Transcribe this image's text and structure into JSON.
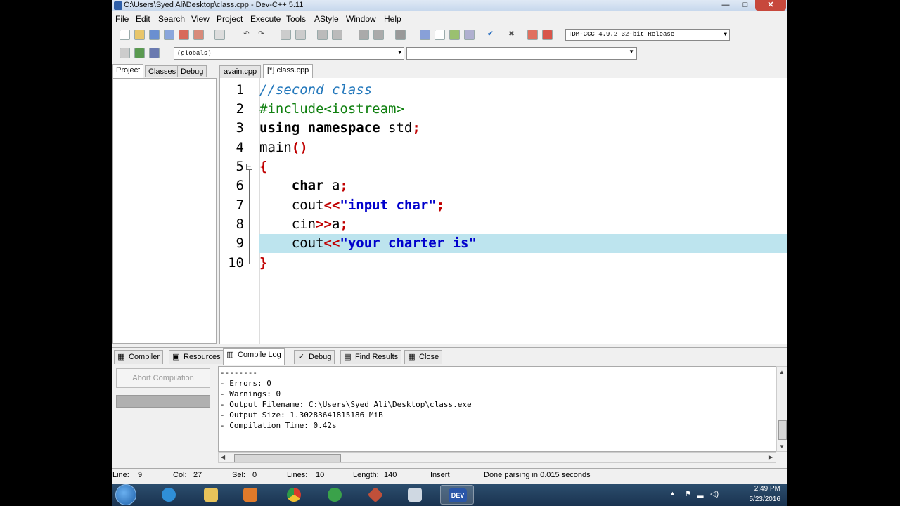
{
  "window": {
    "title": "C:\\Users\\Syed Ali\\Desktop\\class.cpp - Dev-C++ 5.11",
    "minimize": "—",
    "maximize": "□",
    "close": "✕"
  },
  "menu": [
    "File",
    "Edit",
    "Search",
    "View",
    "Project",
    "Execute",
    "Tools",
    "AStyle",
    "Window",
    "Help"
  ],
  "toolbar": {
    "compiler": "TDM-GCC 4.9.2 32-bit Release",
    "scope": "(globals)",
    "member": ""
  },
  "left_tabs": [
    "Project",
    "Classes",
    "Debug"
  ],
  "editor_tabs": [
    "avain.cpp",
    "[*] class.cpp"
  ],
  "code_lines": [
    {
      "num": "1",
      "text": "//second class"
    },
    {
      "num": "2",
      "text": "#include<iostream>"
    },
    {
      "num": "3",
      "text": "using namespace std;"
    },
    {
      "num": "4",
      "text": "main()"
    },
    {
      "num": "5",
      "text": "{"
    },
    {
      "num": "6",
      "text": "    char a;"
    },
    {
      "num": "7",
      "text": "    cout<<\"input char\";"
    },
    {
      "num": "8",
      "text": "    cin>>a;"
    },
    {
      "num": "9",
      "text": "    cout<<\"your charter is\""
    },
    {
      "num": "10",
      "text": "}"
    }
  ],
  "code": {
    "l1_comment": "//second class",
    "l2_pp": "#include<iostream>",
    "l3_kw1": "using",
    "l3_kw2": "namespace",
    "l3_rest": " std",
    "l4_name": "main",
    "l6_kw": "char",
    "l6_rest": " a",
    "l7_id": "cout",
    "l7_str": "\"input char\"",
    "l8_id": "cin",
    "l8_rest": "a",
    "l9_id": "cout",
    "l9_str": "\"your charter is\""
  },
  "bottom_tabs": [
    "Compiler",
    "Resources",
    "Compile Log",
    "Debug",
    "Find Results",
    "Close"
  ],
  "abort_button": "Abort Compilation",
  "log_lines": [
    "--------",
    "- Errors: 0",
    "- Warnings: 0",
    "- Output Filename: C:\\Users\\Syed Ali\\Desktop\\class.exe",
    "- Output Size: 1.30283641815186 MiB",
    "- Compilation Time: 0.42s"
  ],
  "status": {
    "line_label": "Line:",
    "line": "9",
    "col_label": "Col:",
    "col": "27",
    "sel_label": "Sel:",
    "sel": "0",
    "lines_label": "Lines:",
    "lines": "10",
    "length_label": "Length:",
    "length": "140",
    "mode": "Insert",
    "message": "Done parsing in 0.015 seconds"
  },
  "taskbar": {
    "time": "2:49 PM",
    "date": "5/23/2016",
    "dev_label": "DEV"
  },
  "colors": {
    "highlight_line": "#bde4ee",
    "comment": "#2277bb",
    "preprocessor": "#108010",
    "symbol": "#c00000",
    "string": "#0000cc"
  }
}
